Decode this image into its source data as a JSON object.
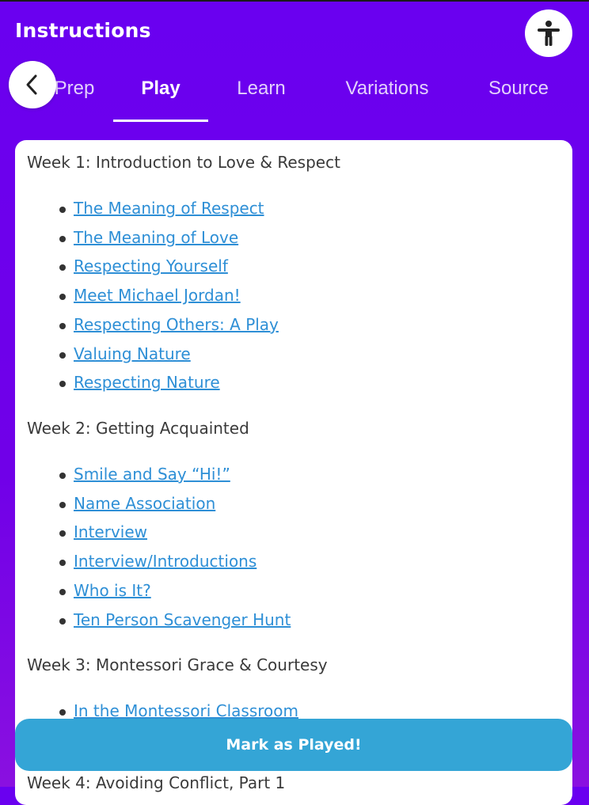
{
  "header": {
    "title": "Instructions",
    "accessibility_icon": "accessibility-person-icon"
  },
  "tabs": [
    {
      "label": "Prep",
      "active": false
    },
    {
      "label": "Play",
      "active": true
    },
    {
      "label": "Learn",
      "active": false
    },
    {
      "label": "Variations",
      "active": false
    },
    {
      "label": "Source",
      "active": false
    }
  ],
  "back_icon": "chevron-left-icon",
  "content": {
    "weeks": [
      {
        "title": "Week 1: Introduction to Love & Respect",
        "items": [
          "The Meaning of Respect",
          "The Meaning of Love",
          "Respecting Yourself",
          "Meet Michael Jordan!",
          "Respecting Others: A Play",
          "Valuing Nature",
          "Respecting Nature"
        ]
      },
      {
        "title": "Week 2: Getting Acquainted",
        "items": [
          "Smile and Say “Hi!”",
          "Name Association",
          "Interview",
          "Interview/Introductions",
          "Who is It?",
          "Ten Person Scavenger Hunt"
        ]
      },
      {
        "title": "Week 3: Montessori Grace & Courtesy",
        "items": [
          "In the Montessori Classroom"
        ]
      },
      {
        "title": "Week 4: Avoiding Conflict, Part 1",
        "items": []
      }
    ]
  },
  "footer": {
    "button_label": "Mark as Played!"
  },
  "colors": {
    "header_bg": "#6a00f0",
    "link": "#2e8fd6",
    "button_bg": "#34a5d6"
  }
}
